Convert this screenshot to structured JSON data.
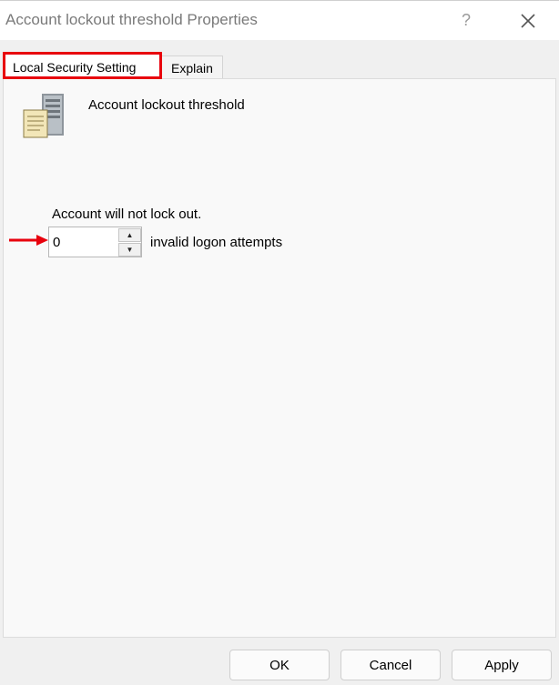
{
  "window": {
    "title": "Account lockout threshold Properties",
    "help_label": "?",
    "close_icon": "close-icon"
  },
  "tabs": [
    {
      "label": "Local Security Setting",
      "selected": true,
      "highlighted": true
    },
    {
      "label": "Explain",
      "selected": false
    }
  ],
  "setting": {
    "icon": "policy-server-icon",
    "name": "Account lockout threshold",
    "status_text": "Account will not lock out.",
    "value": "0",
    "unit_label": "invalid logon attempts",
    "spin_up": "▲",
    "spin_down": "▼"
  },
  "buttons": {
    "ok": "OK",
    "cancel": "Cancel",
    "apply": "Apply"
  },
  "colors": {
    "highlight_red": "#e8000d",
    "dialog_bg": "#f0f0f0",
    "panel_bg": "#f9f9f9"
  }
}
